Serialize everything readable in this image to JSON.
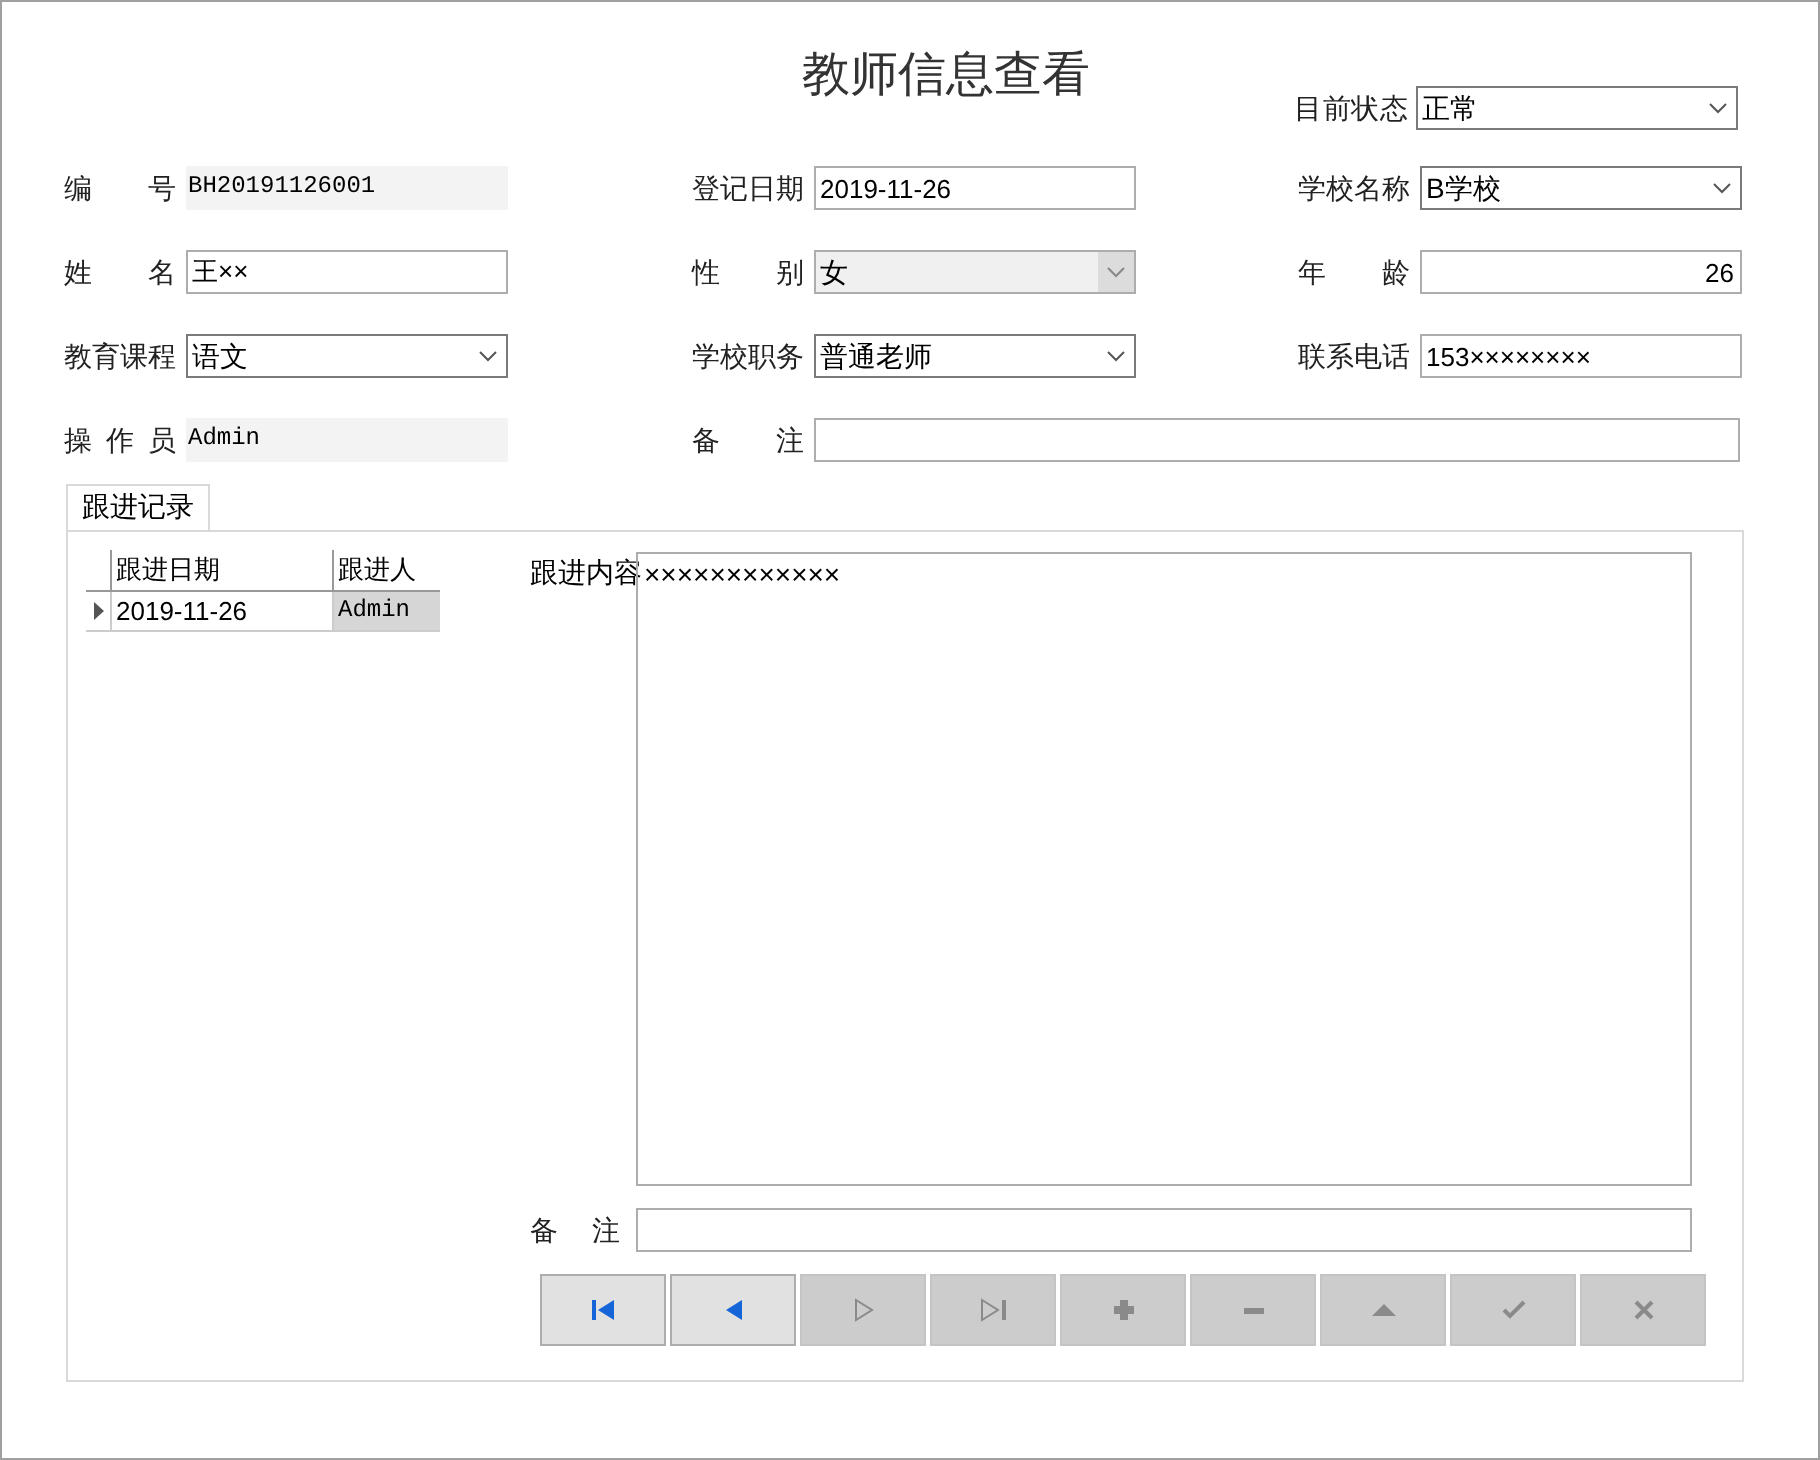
{
  "window": {
    "title": "教师信息查看"
  },
  "status": {
    "label": "目前状态",
    "kind": "combo",
    "value": "正常"
  },
  "fields": [
    {
      "label": "编 号",
      "kind": "readonly",
      "value": "BH20191126001"
    },
    {
      "label": "登记日期",
      "kind": "text",
      "value": "2019-11-26"
    },
    {
      "label": "学校名称",
      "kind": "combo",
      "value": "B学校"
    },
    {
      "label": "姓 名",
      "kind": "text",
      "value": "王××"
    },
    {
      "label": "性 别",
      "kind": "combo_disabled",
      "value": "女"
    },
    {
      "label": "年 龄",
      "kind": "number",
      "value": "26"
    },
    {
      "label": "教育课程",
      "kind": "combo",
      "value": "语文"
    },
    {
      "label": "学校职务",
      "kind": "combo",
      "value": "普通老师"
    },
    {
      "label": "联系电话",
      "kind": "text",
      "value": "153××××××××"
    },
    {
      "label": "操 作 员",
      "kind": "readonly",
      "value": "Admin"
    },
    {
      "label": "备 注",
      "kind": "wide"
    }
  ],
  "tab": {
    "label": "跟进记录",
    "selected": true
  },
  "grid": {
    "columns": [
      "跟进日期",
      "跟进人"
    ],
    "rows": [
      {
        "cells": [
          "2019-11-26",
          "Admin"
        ],
        "selected": true
      }
    ]
  },
  "content": {
    "label": "跟进内容",
    "value": "××××××××××××"
  },
  "notes": {
    "label": "备 注"
  },
  "navigator": [
    {
      "kind": "first",
      "disabled": false
    },
    {
      "kind": "prev",
      "disabled": false
    },
    {
      "kind": "next",
      "disabled": true
    },
    {
      "kind": "last",
      "disabled": true
    },
    {
      "kind": "add",
      "disabled": true
    },
    {
      "kind": "delete",
      "disabled": true
    },
    {
      "kind": "edit",
      "disabled": true
    },
    {
      "kind": "post",
      "disabled": true
    },
    {
      "kind": "cancel",
      "disabled": true
    }
  ]
}
